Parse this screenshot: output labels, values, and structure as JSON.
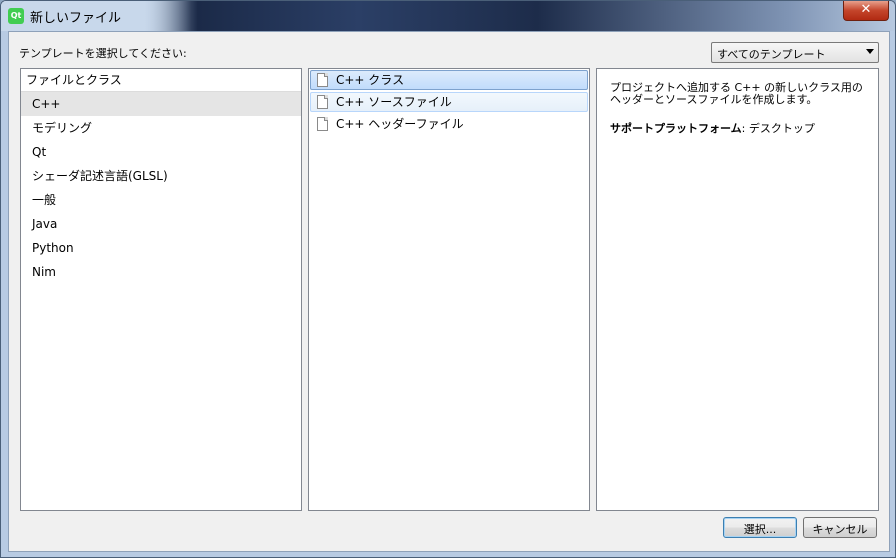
{
  "window": {
    "title": "新しいファイル",
    "icon_label": "Qt",
    "close_symbol": "✕"
  },
  "prompt": "テンプレートを選択してください:",
  "filter": {
    "selected": "すべてのテンプレート"
  },
  "categories": {
    "header": "ファイルとクラス",
    "items": [
      "C++",
      "モデリング",
      "Qt",
      "シェーダ記述言語(GLSL)",
      "一般",
      "Java",
      "Python",
      "Nim"
    ],
    "selected_index": 0
  },
  "templates": {
    "items": [
      "C++ クラス",
      "C++ ソースファイル",
      "C++ ヘッダーファイル"
    ],
    "selected_index": 0,
    "hover_index": 1
  },
  "description": {
    "text": "プロジェクトへ追加する C++ の新しいクラス用のヘッダーとソースファイルを作成します。",
    "platform_label": "サポートプラットフォーム",
    "platform_value": ": デスクトップ"
  },
  "buttons": {
    "choose": "選択...",
    "cancel": "キャンセル"
  }
}
